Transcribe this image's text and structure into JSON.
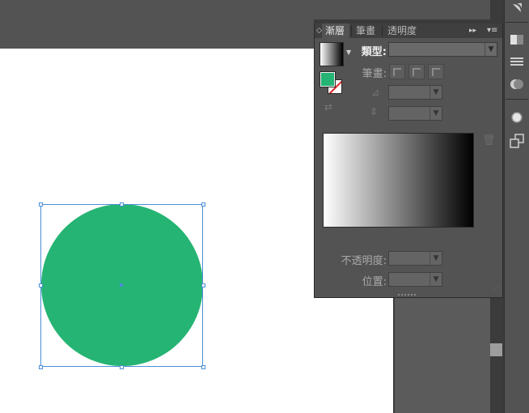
{
  "panel": {
    "tabs": [
      {
        "label": "漸層",
        "active": true
      },
      {
        "label": "筆畫",
        "active": false
      },
      {
        "label": "透明度",
        "active": false
      }
    ],
    "collapse_glyph": "◇",
    "more_glyph": "▸▸",
    "menu_glyph": "▾≡",
    "thumb_arrow_glyph": "▼",
    "type_label": "類型:",
    "type_value": "",
    "stroke_label": "筆畫:",
    "angle_icon_glyph": "⊿",
    "aspect_icon_glyph": "⇕",
    "opacity_label": "不透明度:",
    "position_label": "位置:",
    "delete_glyph": "🗑",
    "reverse_glyph": "⇄",
    "dropdown_arrow_glyph": "▼",
    "resize_glyph": "⋰"
  },
  "colors": {
    "fill": "#25b473",
    "selection": "#4b8fd7",
    "gradient_start": "#ffffff",
    "gradient_end": "#000000",
    "ui_background": "#535353"
  },
  "icons": [
    "gradient-thumbnail-icon",
    "fill-swatch-icon",
    "stroke-swatch-icon",
    "reverse-gradient-icon",
    "angle-icon",
    "aspect-ratio-icon",
    "delete-stop-icon"
  ]
}
